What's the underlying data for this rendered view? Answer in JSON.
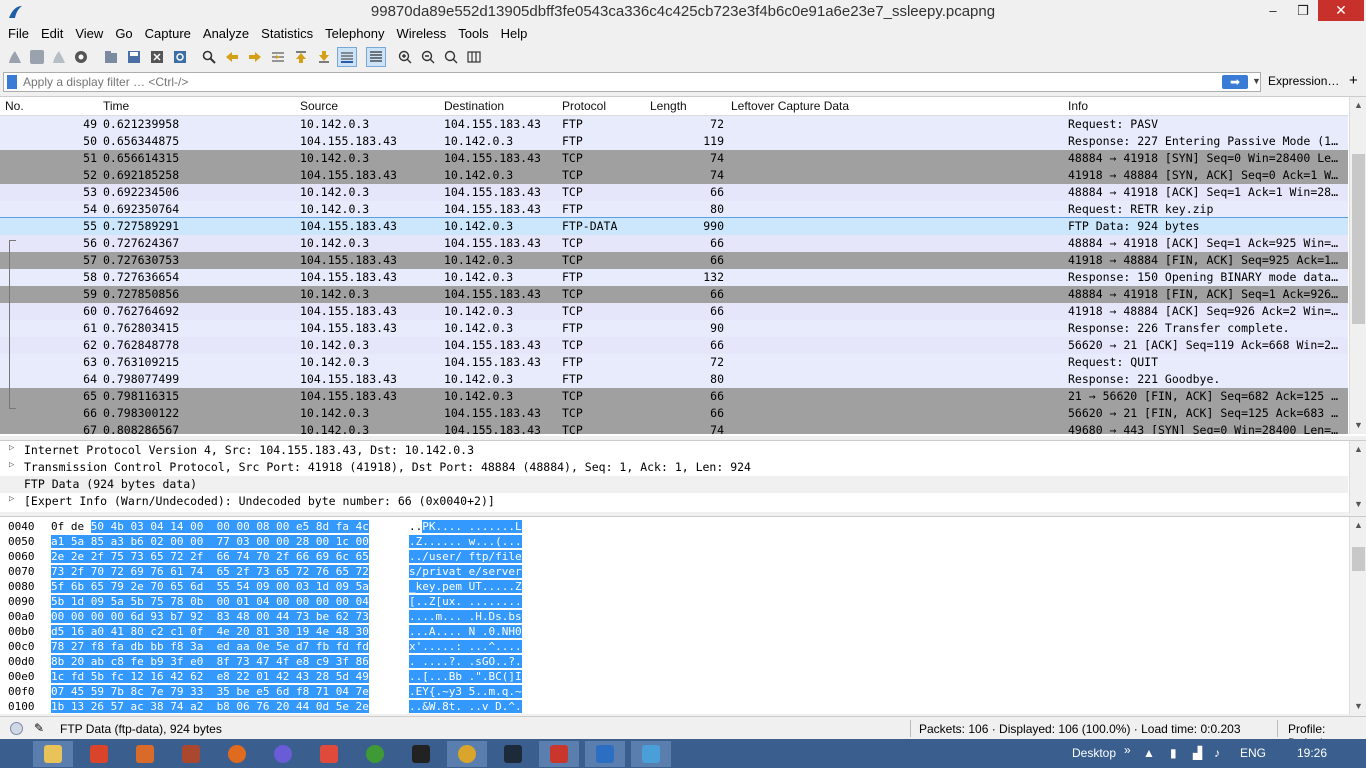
{
  "window": {
    "title": "99870da89e552d13905dbff3fe0543ca336c4c425cb723e3f4b6c0e91a6e23e7_ssleepy.pcapng",
    "minimize": "–",
    "maximize": "❒",
    "close": "✕"
  },
  "menu": [
    "File",
    "Edit",
    "View",
    "Go",
    "Capture",
    "Analyze",
    "Statistics",
    "Telephony",
    "Wireless",
    "Tools",
    "Help"
  ],
  "filter": {
    "placeholder": "Apply a display filter … <Ctrl-/>",
    "apply_arrow": "➡",
    "dropdown": "▼",
    "expression_label": "Expression…",
    "plus": "+"
  },
  "packet_list": {
    "columns": {
      "no": "No.",
      "time": "Time",
      "source": "Source",
      "destination": "Destination",
      "protocol": "Protocol",
      "length": "Length",
      "leftover": "Leftover Capture Data",
      "info": "Info"
    },
    "rows": [
      {
        "no": "49",
        "time": "0.621239958",
        "src": "10.142.0.3",
        "dst": "104.155.183.43",
        "proto": "FTP",
        "len": "72",
        "info": "Request: PASV",
        "style": "ftp"
      },
      {
        "no": "50",
        "time": "0.656344875",
        "src": "104.155.183.43",
        "dst": "10.142.0.3",
        "proto": "FTP",
        "len": "119",
        "info": "Response: 227 Entering Passive Mode (1…",
        "style": "ftp"
      },
      {
        "no": "51",
        "time": "0.656614315",
        "src": "10.142.0.3",
        "dst": "104.155.183.43",
        "proto": "TCP",
        "len": "74",
        "info": "48884 → 41918 [SYN] Seq=0 Win=28400 Le…",
        "style": "syn"
      },
      {
        "no": "52",
        "time": "0.692185258",
        "src": "104.155.183.43",
        "dst": "10.142.0.3",
        "proto": "TCP",
        "len": "74",
        "info": "41918 → 48884 [SYN, ACK] Seq=0 Ack=1 W…",
        "style": "syn"
      },
      {
        "no": "53",
        "time": "0.692234506",
        "src": "10.142.0.3",
        "dst": "104.155.183.43",
        "proto": "TCP",
        "len": "66",
        "info": "48884 → 41918 [ACK] Seq=1 Ack=1 Win=28…",
        "style": "tcp"
      },
      {
        "no": "54",
        "time": "0.692350764",
        "src": "10.142.0.3",
        "dst": "104.155.183.43",
        "proto": "FTP",
        "len": "80",
        "info": "Request: RETR key.zip",
        "style": "ftp"
      },
      {
        "no": "55",
        "time": "0.727589291",
        "src": "104.155.183.43",
        "dst": "10.142.0.3",
        "proto": "FTP-DATA",
        "len": "990",
        "info": "FTP Data: 924 bytes",
        "style": "selected"
      },
      {
        "no": "56",
        "time": "0.727624367",
        "src": "10.142.0.3",
        "dst": "104.155.183.43",
        "proto": "TCP",
        "len": "66",
        "info": "48884 → 41918 [ACK] Seq=1 Ack=925 Win=…",
        "style": "tcp"
      },
      {
        "no": "57",
        "time": "0.727630753",
        "src": "104.155.183.43",
        "dst": "10.142.0.3",
        "proto": "TCP",
        "len": "66",
        "info": "41918 → 48884 [FIN, ACK] Seq=925 Ack=1…",
        "style": "syn"
      },
      {
        "no": "58",
        "time": "0.727636654",
        "src": "104.155.183.43",
        "dst": "10.142.0.3",
        "proto": "FTP",
        "len": "132",
        "info": "Response: 150 Opening BINARY mode data…",
        "style": "ftp"
      },
      {
        "no": "59",
        "time": "0.727850856",
        "src": "10.142.0.3",
        "dst": "104.155.183.43",
        "proto": "TCP",
        "len": "66",
        "info": "48884 → 41918 [FIN, ACK] Seq=1 Ack=926…",
        "style": "syn"
      },
      {
        "no": "60",
        "time": "0.762764692",
        "src": "104.155.183.43",
        "dst": "10.142.0.3",
        "proto": "TCP",
        "len": "66",
        "info": "41918 → 48884 [ACK] Seq=926 Ack=2 Win=…",
        "style": "tcp"
      },
      {
        "no": "61",
        "time": "0.762803415",
        "src": "104.155.183.43",
        "dst": "10.142.0.3",
        "proto": "FTP",
        "len": "90",
        "info": "Response: 226 Transfer complete.",
        "style": "ftp"
      },
      {
        "no": "62",
        "time": "0.762848778",
        "src": "10.142.0.3",
        "dst": "104.155.183.43",
        "proto": "TCP",
        "len": "66",
        "info": "56620 → 21 [ACK] Seq=119 Ack=668 Win=2…",
        "style": "tcp"
      },
      {
        "no": "63",
        "time": "0.763109215",
        "src": "10.142.0.3",
        "dst": "104.155.183.43",
        "proto": "FTP",
        "len": "72",
        "info": "Request: QUIT",
        "style": "ftp"
      },
      {
        "no": "64",
        "time": "0.798077499",
        "src": "104.155.183.43",
        "dst": "10.142.0.3",
        "proto": "FTP",
        "len": "80",
        "info": "Response: 221 Goodbye.",
        "style": "ftp"
      },
      {
        "no": "65",
        "time": "0.798116315",
        "src": "104.155.183.43",
        "dst": "10.142.0.3",
        "proto": "TCP",
        "len": "66",
        "info": "21 → 56620 [FIN, ACK] Seq=682 Ack=125 …",
        "style": "syn"
      },
      {
        "no": "66",
        "time": "0.798300122",
        "src": "10.142.0.3",
        "dst": "104.155.183.43",
        "proto": "TCP",
        "len": "66",
        "info": "56620 → 21 [FIN, ACK] Seq=125 Ack=683 …",
        "style": "syn"
      },
      {
        "no": "67",
        "time": "0.808286567",
        "src": "10.142.0.3",
        "dst": "104.155.183.43",
        "proto": "TCP",
        "len": "74",
        "info": "49680 → 443 [SYN] Seq=0 Win=28400 Len=…",
        "style": "syn"
      }
    ]
  },
  "details": [
    {
      "text": "Internet Protocol Version 4, Src: 104.155.183.43, Dst: 10.142.0.3",
      "expand": "▷",
      "hl": false
    },
    {
      "text": "Transmission Control Protocol, Src Port: 41918 (41918), Dst Port: 48884 (48884), Seq: 1, Ack: 1, Len: 924",
      "expand": "▷",
      "hl": false
    },
    {
      "text": "FTP Data (924 bytes data)",
      "expand": "",
      "hl": true
    },
    {
      "text": "[Expert Info (Warn/Undecoded): Undecoded byte number: 66 (0x0040+2)]",
      "expand": "▷",
      "hl": false
    }
  ],
  "bytes": [
    {
      "off": "0040",
      "hex_pre": "0f de ",
      "hex": "50 4b 03 04 14 00  00 00 08 00 e5 8d fa 4c",
      "ascii_pre": "..",
      "ascii": "PK.... .......L"
    },
    {
      "off": "0050",
      "hex_pre": "",
      "hex": "a1 5a 85 a3 b6 02 00 00  77 03 00 00 28 00 1c 00",
      "ascii_pre": "",
      "ascii": ".Z...... w...(..."
    },
    {
      "off": "0060",
      "hex_pre": "",
      "hex": "2e 2e 2f 75 73 65 72 2f  66 74 70 2f 66 69 6c 65",
      "ascii_pre": "",
      "ascii": "../user/ ftp/file"
    },
    {
      "off": "0070",
      "hex_pre": "",
      "hex": "73 2f 70 72 69 76 61 74  65 2f 73 65 72 76 65 72",
      "ascii_pre": "",
      "ascii": "s/privat e/server"
    },
    {
      "off": "0080",
      "hex_pre": "",
      "hex": "5f 6b 65 79 2e 70 65 6d  55 54 09 00 03 1d 09 5a",
      "ascii_pre": "",
      "ascii": "_key.pem UT.....Z"
    },
    {
      "off": "0090",
      "hex_pre": "",
      "hex": "5b 1d 09 5a 5b 75 78 0b  00 01 04 00 00 00 00 04",
      "ascii_pre": "",
      "ascii": "[..Z[ux. ........"
    },
    {
      "off": "00a0",
      "hex_pre": "",
      "hex": "00 00 00 00 6d 93 b7 92  83 48 00 44 73 be 62 73",
      "ascii_pre": "",
      "ascii": "....m... .H.Ds.bs"
    },
    {
      "off": "00b0",
      "hex_pre": "",
      "hex": "d5 16 a0 41 80 c2 c1 0f  4e 20 81 30 19 4e 48 30",
      "ascii_pre": "",
      "ascii": "...A.... N .0.NH0"
    },
    {
      "off": "00c0",
      "hex_pre": "",
      "hex": "78 27 f8 fa db bb f8 3a  ed aa 0e 5e d7 fb fd fd",
      "ascii_pre": "",
      "ascii": "x'.....: ...^...."
    },
    {
      "off": "00d0",
      "hex_pre": "",
      "hex": "8b 20 ab c8 fe b9 3f e0  8f 73 47 4f e8 c9 3f 86",
      "ascii_pre": "",
      "ascii": ". ....?. .sGO..?."
    },
    {
      "off": "00e0",
      "hex_pre": "",
      "hex": "1c fd 5b fc 12 16 42 62  e8 22 01 42 43 28 5d 49",
      "ascii_pre": "",
      "ascii": "..[...Bb .\".BC(]I"
    },
    {
      "off": "00f0",
      "hex_pre": "",
      "hex": "07 45 59 7b 8c 7e 79 33  35 be e5 6d f8 71 04 7e",
      "ascii_pre": "",
      "ascii": ".EY{.~y3 5..m.q.~"
    },
    {
      "off": "0100",
      "hex_pre": "",
      "hex": "1b 13 26 57 ac 38 74 a2  b8 06 76 20 44 0d 5e 2e",
      "ascii_pre": "",
      "ascii": "..&W.8t. ..v D.^."
    }
  ],
  "status": {
    "left": "FTP Data (ftp-data), 924 bytes",
    "packets": "Packets: 106 · Displayed: 106 (100.0%) · Load time: 0:0.203",
    "profile": "Profile: Default"
  },
  "taskbar": {
    "desktop_label": "Desktop",
    "chevron": "»",
    "language": "ENG",
    "clock": "19:26"
  },
  "colors": {
    "accent": "#3399ff",
    "ftp_row": "#e8ebfb",
    "tcp_syn_row": "#a0a0a0",
    "taskbar": "#3a5f8f"
  }
}
